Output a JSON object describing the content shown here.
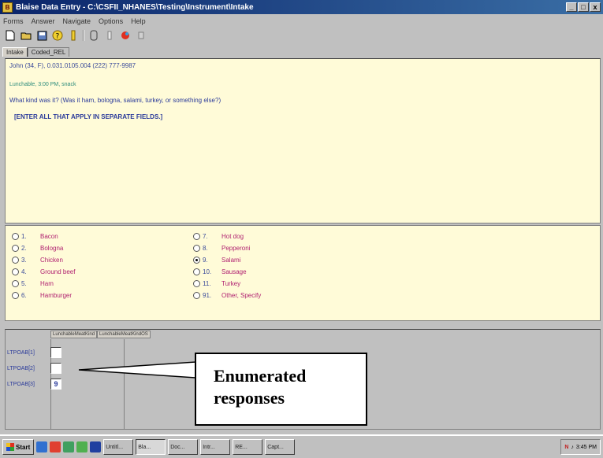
{
  "window": {
    "title": "Blaise Data Entry - C:\\CSFII_NHANES\\Testing\\Instrument\\Intake",
    "min_glyph": "_",
    "max_glyph": "□",
    "close_glyph": "x"
  },
  "menu": [
    "Forms",
    "Answer",
    "Navigate",
    "Options",
    "Help"
  ],
  "tabs": [
    {
      "label": "Intake"
    },
    {
      "label": "Coded_REL"
    }
  ],
  "question": {
    "header": "John (34, F),    0.031.0105.004  (222) 777-9987",
    "context": "Lunchable, 3:00 PM, snack",
    "text": "What kind was it? (Was it ham, bologna, salami, turkey, or something else?)",
    "instruction": "[ENTER ALL THAT APPLY IN SEPARATE FIELDS.]"
  },
  "answers": [
    {
      "code": "1.",
      "label": "Bacon",
      "selected": false
    },
    {
      "code": "2.",
      "label": "Bologna",
      "selected": false
    },
    {
      "code": "3.",
      "label": "Chicken",
      "selected": false
    },
    {
      "code": "4.",
      "label": "Ground beef",
      "selected": false
    },
    {
      "code": "5.",
      "label": "Ham",
      "selected": false
    },
    {
      "code": "6.",
      "label": "Hamburger",
      "selected": false
    },
    {
      "code": "7.",
      "label": "Hot dog",
      "selected": false
    },
    {
      "code": "8.",
      "label": "Pepperoni",
      "selected": false
    },
    {
      "code": "9.",
      "label": "Salami",
      "selected": true
    },
    {
      "code": "10.",
      "label": "Sausage",
      "selected": false
    },
    {
      "code": "11.",
      "label": "Turkey",
      "selected": false
    },
    {
      "code": "91.",
      "label": "Other, Specify",
      "selected": false
    }
  ],
  "grid": {
    "col1": "LunchableMeatKind",
    "col2": "LunchableMeatKindOS",
    "rows": [
      {
        "label": "LTPOAB[1]",
        "value": ""
      },
      {
        "label": "LTPOAB[2]",
        "value": ""
      },
      {
        "label": "LTPOAB[3]",
        "value": "9"
      }
    ]
  },
  "callout": {
    "line1": "Enumerated",
    "line2": "responses"
  },
  "taskbar": {
    "start": "Start",
    "tasks": [
      "Untitl...",
      "Bla...",
      "Doc...",
      "Intr...",
      "RE...",
      "Capt..."
    ],
    "clock": "3:45 PM"
  }
}
